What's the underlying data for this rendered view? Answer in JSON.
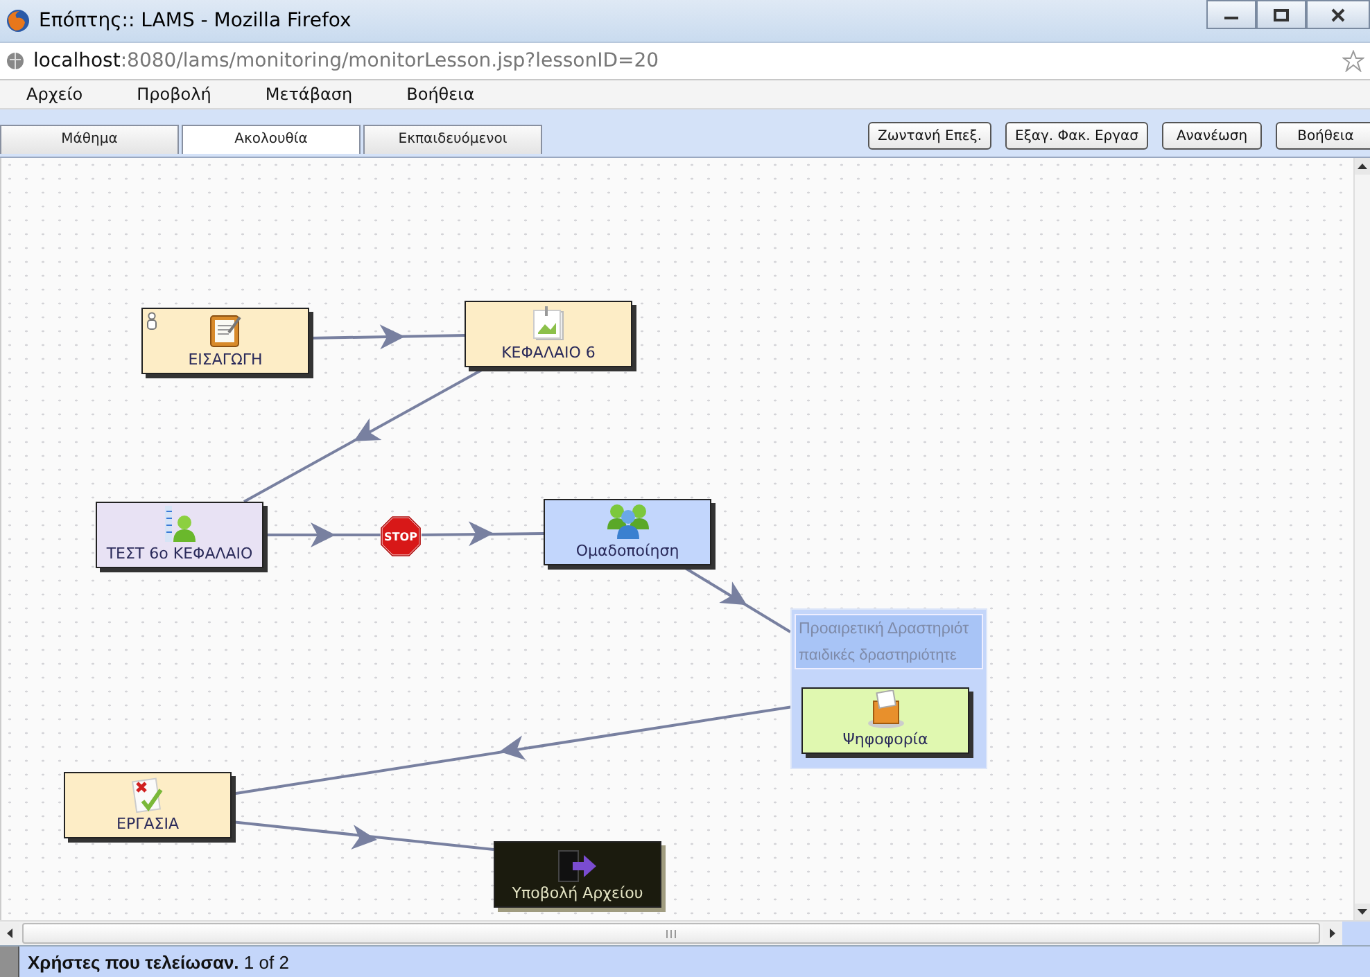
{
  "window": {
    "title": "Επόπτης:: LAMS - Mozilla Firefox"
  },
  "address_bar": {
    "host": "localhost",
    "path": ":8080/lams/monitoring/monitorLesson.jsp?lessonID=20"
  },
  "menu": [
    "Αρχείο",
    "Προβολή",
    "Μετάβαση",
    "Βοήθεια"
  ],
  "tabs": [
    {
      "label": "Μάθημα",
      "selected": false
    },
    {
      "label": "Ακολουθία",
      "selected": true
    },
    {
      "label": "Εκπαιδευόμενοι",
      "selected": false
    }
  ],
  "toolbar_buttons": [
    "Ζωντανή Επεξ.",
    "Εξαγ. Φακ. Εργασ",
    "Ανανέωση",
    "Βοήθεια"
  ],
  "activities": [
    {
      "label": "ΕΙΣΑΓΩΓΗ",
      "kind": "notice",
      "color": "#fdedc6",
      "start": true
    },
    {
      "label": "ΚΕΦΑΛΑΙΟ 6",
      "kind": "image",
      "color": "#fdedc6",
      "start": false
    },
    {
      "label": "ΤΕΣΤ 6ο ΚΕΦΑΛΑΙΟ",
      "kind": "assessment",
      "color": "#e8e2f4",
      "start": false
    },
    {
      "label": "Ομαδοποίηση",
      "kind": "grouping",
      "color": "#c2d6fc",
      "start": false
    },
    {
      "label": "ΕΡΓΑΣΙΑ",
      "kind": "task",
      "color": "#fdedc6",
      "start": false
    },
    {
      "label": "Υποβολή Αρχείου",
      "kind": "submit",
      "color": "#1b1b0e",
      "start": false
    }
  ],
  "gates": [
    {
      "label": "STOP"
    }
  ],
  "optional_sequence": {
    "title": "Προαιρετική Δραστηριότ",
    "subtitle": "παιδικές δραστηριότητε",
    "activities": [
      {
        "label": "Ψηφοφορία",
        "kind": "voting",
        "color": "#e0f8b0",
        "start": false
      }
    ]
  },
  "status_bar": {
    "text": "**Χρήστες που τελείωσαν.** 1 of 2"
  }
}
